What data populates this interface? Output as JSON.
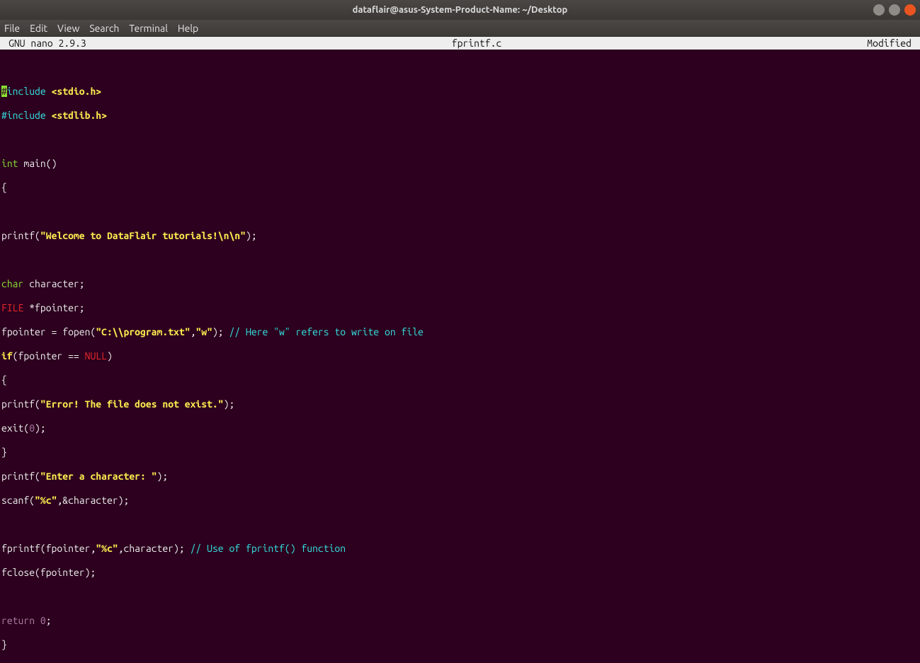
{
  "window": {
    "title": "dataflair@asus-System-Product-Name: ~/Desktop"
  },
  "menu": {
    "file": "File",
    "edit": "Edit",
    "view": "View",
    "search": "Search",
    "terminal": "Terminal",
    "help": "Help"
  },
  "status": {
    "left": "  GNU nano 2.9.3",
    "center": "fprintf.c",
    "right": "Modified"
  },
  "code": {
    "l1a": "#",
    "l1b": "include ",
    "l1c": "<stdio.h>",
    "l2a": "#include ",
    "l2b": "<stdlib.h>",
    "l4a": "int",
    "l4b": " main()",
    "l5": "{",
    "l7a": "printf(",
    "l7b": "\"Welcome to DataFlair tutorials!\\n\\n\"",
    "l7c": ");",
    "l9a": "char",
    "l9b": " character;",
    "l10a": "FILE",
    "l10b": " *fpointer;",
    "l11a": "fpointer = fopen(",
    "l11b": "\"C:\\\\program.txt\"",
    "l11c": ",",
    "l11d": "\"w\"",
    "l11e": "); ",
    "l11f": "// Here \"w\" refers to write on file",
    "l12a": "if",
    "l12b": "(fpointer == ",
    "l12c": "NULL",
    "l12d": ")",
    "l13": "{",
    "l14a": "printf(",
    "l14b": "\"Error! The file does not exist.\"",
    "l14c": ");",
    "l15a": "exit(",
    "l15b": "0",
    "l15c": ");",
    "l16": "}",
    "l17a": "printf(",
    "l17b": "\"Enter a character: \"",
    "l17c": ");",
    "l18a": "scanf(",
    "l18b": "\"%c\"",
    "l18c": ",&character);",
    "l20a": "fprintf(fpointer,",
    "l20b": "\"%c\"",
    "l20c": ",character); ",
    "l20d": "// Use of fprintf() function",
    "l21": "fclose(fpointer);",
    "l23a": "return ",
    "l23b": "0",
    "l23c": ";",
    "l24": "}"
  }
}
